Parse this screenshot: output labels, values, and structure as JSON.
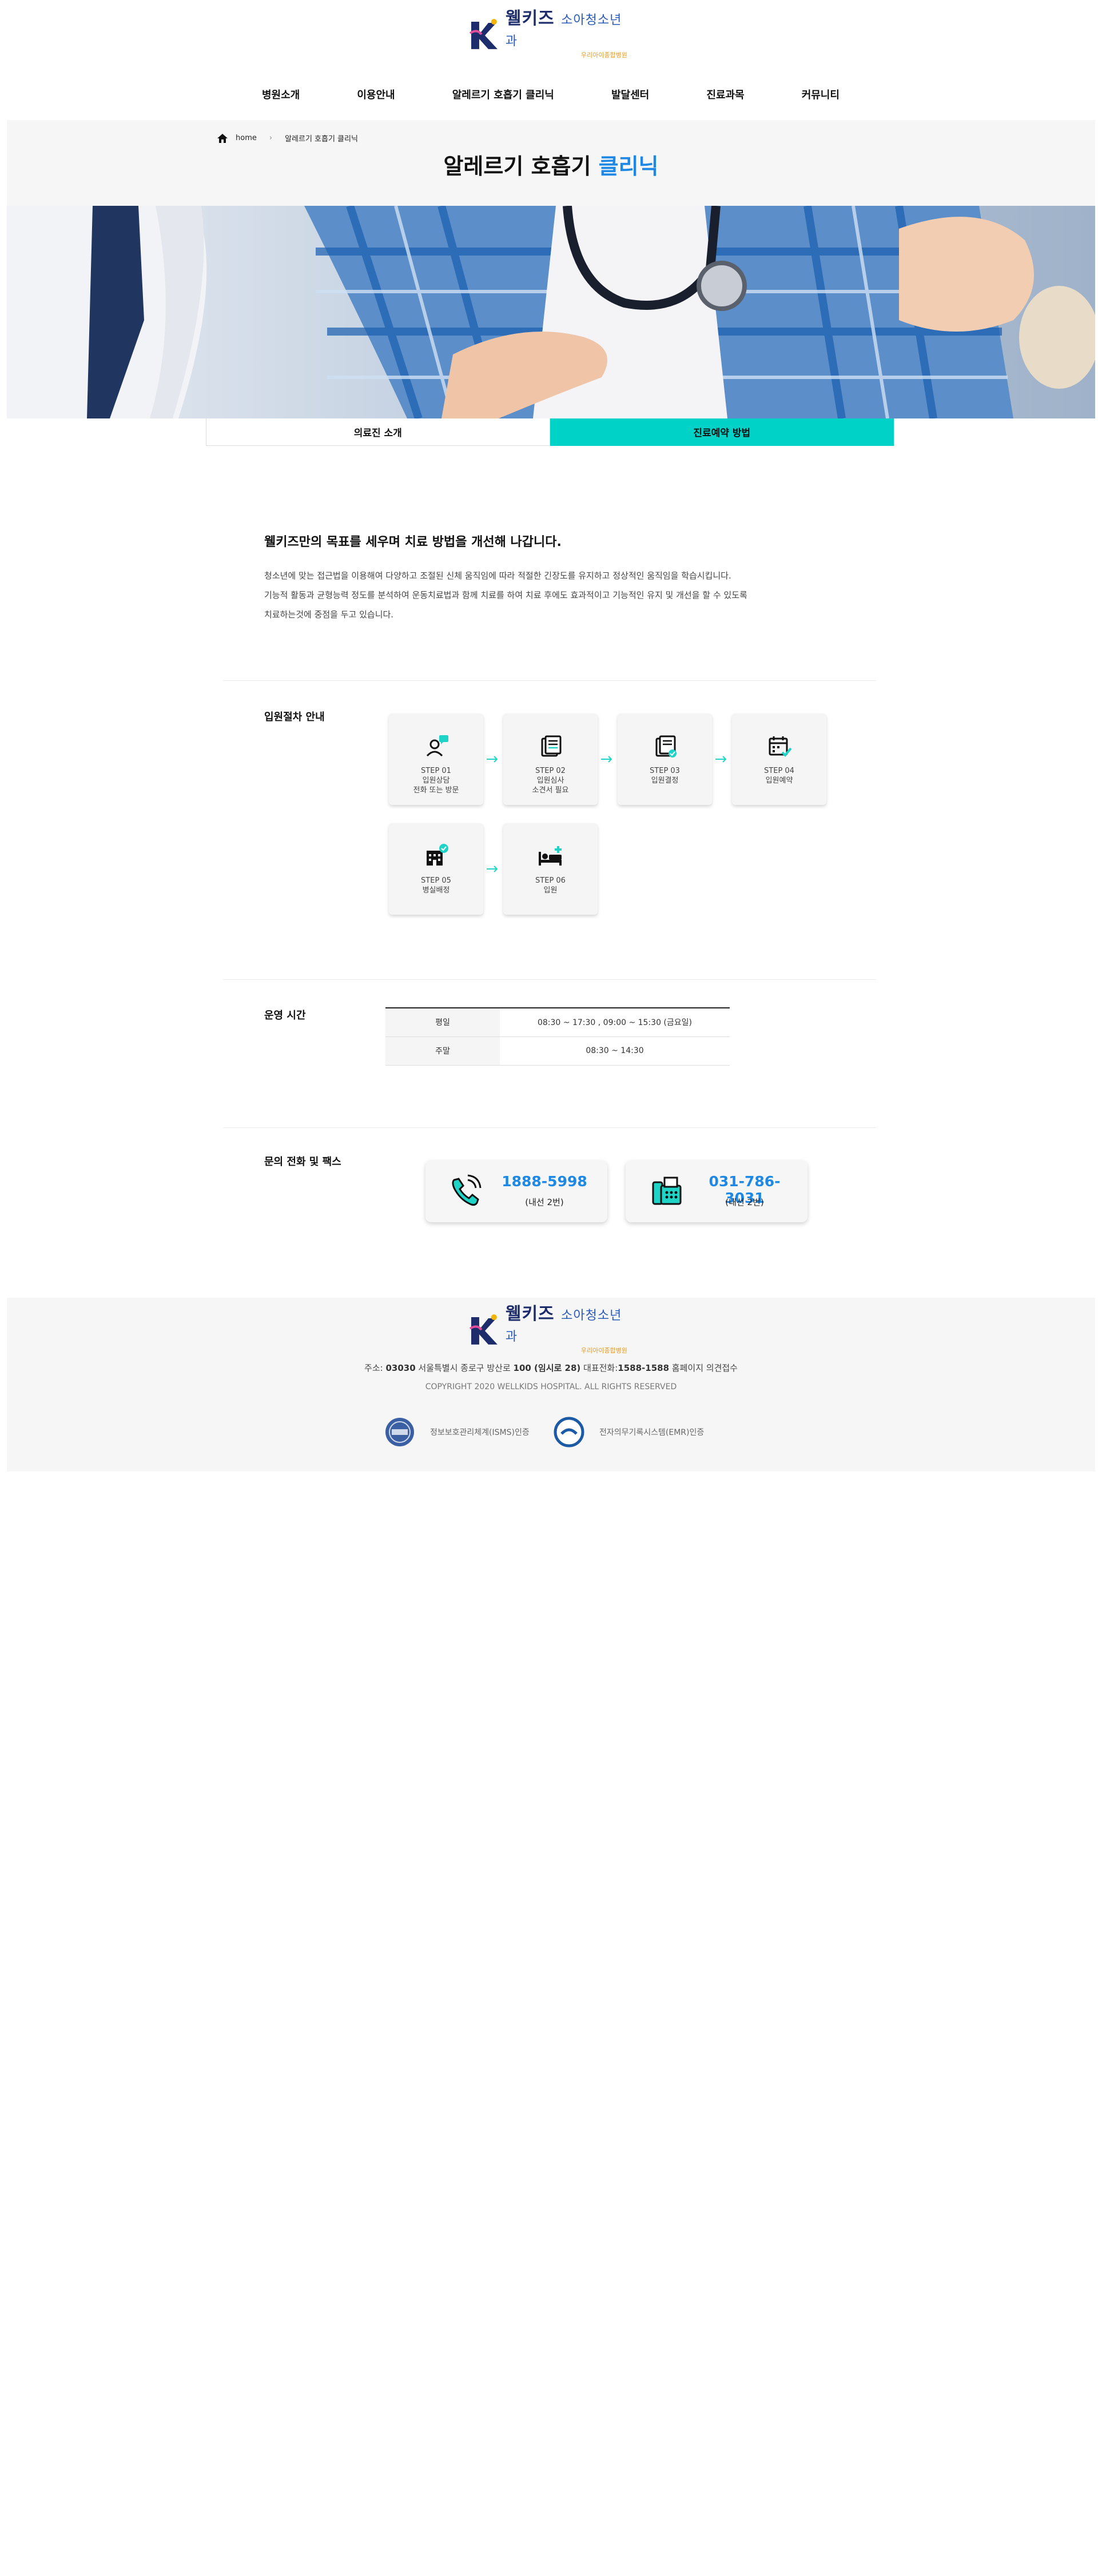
{
  "brand": {
    "name": "웰키즈",
    "sub": "소아청소년과",
    "tag": "우리아이종합병원"
  },
  "nav": [
    "병원소개",
    "이용안내",
    "알레르기 호흡기 클리닉",
    "발달센터",
    "진료과목",
    "커뮤니티"
  ],
  "breadcrumb": {
    "home": "home",
    "current": "알레르기 호흡기 클리닉"
  },
  "title": {
    "main": "알레르기 호흡기",
    "accent": "클리닉"
  },
  "tabs": [
    {
      "label": "의료진 소개",
      "active": false
    },
    {
      "label": "진료예약 방법",
      "active": true
    }
  ],
  "intro": {
    "heading": "웰키즈만의 목표를 세우며 치료 방법을 개선해 나갑니다.",
    "lines": [
      "청소년에 맞는 접근법을 이용해여 다양하고 조절된 신체 움직임에 따라 적절한 긴장도를 유지하고 정상적인 움직임을 학습시킵니다.",
      "기능적 활동과 균형능력 정도를 분석하여 운동치료법과 함께 치료를 하여 치료 후에도 효과적이고 기능적인 유지 및 개선을 할 수 있도록",
      "치료하는것에 중점을 두고 있습니다."
    ]
  },
  "steps_section": {
    "label": "입원절차 안내",
    "steps": [
      {
        "step": "STEP 01",
        "lines": [
          "입원상담",
          "전화 또는 방문"
        ],
        "icon": "consult-person-icon"
      },
      {
        "step": "STEP 02",
        "lines": [
          "입원심사",
          "소견서 필요"
        ],
        "icon": "document-review-icon"
      },
      {
        "step": "STEP 03",
        "lines": [
          "입원결정"
        ],
        "icon": "document-approved-icon"
      },
      {
        "step": "STEP 04",
        "lines": [
          "입원예약"
        ],
        "icon": "calendar-check-icon"
      },
      {
        "step": "STEP 05",
        "lines": [
          "병실배정"
        ],
        "icon": "hospital-check-icon"
      },
      {
        "step": "STEP 06",
        "lines": [
          "입원"
        ],
        "icon": "hospital-bed-icon"
      }
    ]
  },
  "hours_section": {
    "label": "운영 시간",
    "rows": [
      {
        "day": "평일",
        "time": "08:30 ~ 17:30 , 09:00 ~ 15:30 (금요일)"
      },
      {
        "day": "주말",
        "time": "08:30 ~ 14:30"
      }
    ]
  },
  "contact_section": {
    "label": "문의 전화 및 팩스",
    "items": [
      {
        "number": "1888-5998",
        "ext": "(내선 2번)",
        "icon": "phone-icon"
      },
      {
        "number": "031-786-3031",
        "ext": "(내선 2번)",
        "icon": "fax-icon"
      }
    ]
  },
  "footer": {
    "address_prefix": "주소: ",
    "zip": "03030",
    "address": " 서울특별시 종로구 방산로 ",
    "bldg": "100 (임시로 28)",
    "tel_label": " 대표전화:",
    "tel": "1588-1588",
    "after": " 홈페이지 의견접수",
    "copyright": "COPYRIGHT 2020 WELLKIDS HOSPITAL. ALL RIGHTS RESERVED",
    "certs": [
      "정보보호관리체계(ISMS)인증",
      "전자의무기록시스템(EMR)인증"
    ]
  },
  "colors": {
    "accent": "#1e88e5",
    "tab_active": "#00d2c8",
    "teal_icon": "#1fd3c7"
  }
}
